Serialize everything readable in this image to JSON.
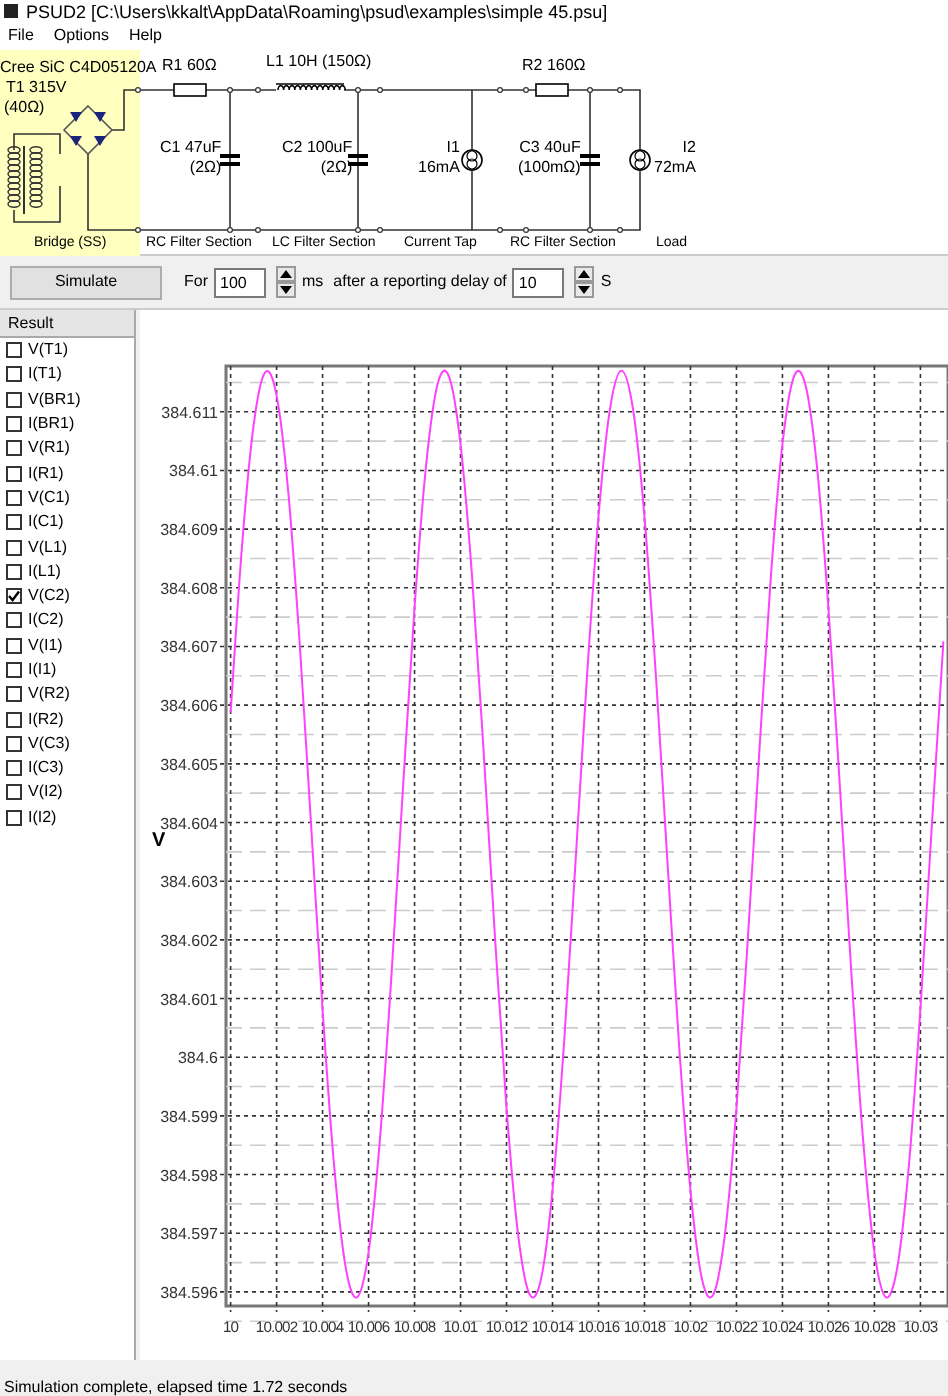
{
  "window": {
    "title": "PSUD2  [C:\\Users\\kkalt\\AppData\\Roaming\\psud\\examples\\simple 45.psu]"
  },
  "menu": [
    "File",
    "Options",
    "Help"
  ],
  "schematic": {
    "bridge": {
      "device": "Cree SiC C4D05120A",
      "transformer": "T1 315V",
      "resistance": "(40Ω)"
    },
    "components": [
      {
        "kind": "resistor",
        "lines": [
          "R1 60Ω"
        ]
      },
      {
        "kind": "capacitor",
        "lines": [
          "C1 47uF",
          "(2Ω)"
        ]
      },
      {
        "kind": "inductor",
        "lines": [
          "L1 10H (150Ω)"
        ]
      },
      {
        "kind": "capacitor",
        "lines": [
          "C2 100uF",
          "(2Ω)"
        ]
      },
      {
        "kind": "current_source",
        "lines": [
          "I1",
          "16mA"
        ]
      },
      {
        "kind": "resistor",
        "lines": [
          "R2 160Ω"
        ]
      },
      {
        "kind": "capacitor",
        "lines": [
          "C3 40uF",
          "(100mΩ)"
        ]
      },
      {
        "kind": "current_source",
        "lines": [
          "I2",
          "72mA"
        ]
      }
    ],
    "sections": [
      "Bridge (SS)",
      "RC Filter Section",
      "LC Filter Section",
      "Current Tap",
      "RC Filter Section",
      "Load"
    ]
  },
  "toolbar": {
    "button": "Simulate",
    "for_label": "For",
    "duration": "100",
    "duration_unit": "ms",
    "delay_label": "after a reporting delay of",
    "delay": "10",
    "delay_unit": "S"
  },
  "results": {
    "header": "Result",
    "items": [
      {
        "label": "V(T1)",
        "checked": false
      },
      {
        "label": "I(T1)",
        "checked": false
      },
      {
        "label": "V(BR1)",
        "checked": false
      },
      {
        "label": "I(BR1)",
        "checked": false
      },
      {
        "label": "V(R1)",
        "checked": false
      },
      {
        "label": "I(R1)",
        "checked": false
      },
      {
        "label": "V(C1)",
        "checked": false
      },
      {
        "label": "I(C1)",
        "checked": false
      },
      {
        "label": "V(L1)",
        "checked": false
      },
      {
        "label": "I(L1)",
        "checked": false
      },
      {
        "label": "V(C2)",
        "checked": true
      },
      {
        "label": "I(C2)",
        "checked": false
      },
      {
        "label": "V(I1)",
        "checked": false
      },
      {
        "label": "I(I1)",
        "checked": false
      },
      {
        "label": "V(R2)",
        "checked": false
      },
      {
        "label": "I(R2)",
        "checked": false
      },
      {
        "label": "V(C3)",
        "checked": false
      },
      {
        "label": "I(C3)",
        "checked": false
      },
      {
        "label": "V(I2)",
        "checked": false
      },
      {
        "label": "I(I2)",
        "checked": false
      }
    ]
  },
  "chart": {
    "chart_data": {
      "type": "line",
      "ylabel": "V",
      "grid": true,
      "x": [
        10,
        10.0005,
        10.001,
        10.0015,
        10.002,
        10.0025,
        10.003,
        10.0035,
        10.004,
        10.0045,
        10.005,
        10.0055,
        10.006,
        10.0065,
        10.007,
        10.0075,
        10.008,
        10.0085,
        10.009,
        10.0095,
        10.01,
        10.0105,
        10.011,
        10.0115,
        10.012,
        10.0125,
        10.013,
        10.0135,
        10.014,
        10.0145,
        10.015,
        10.0155,
        10.016,
        10.0165,
        10.017,
        10.0175,
        10.018,
        10.0185,
        10.019,
        10.0195,
        10.02,
        10.0205,
        10.021,
        10.0215,
        10.022,
        10.0225,
        10.023,
        10.0235,
        10.024,
        10.0245,
        10.025,
        10.0255,
        10.026,
        10.0265,
        10.027,
        10.0275,
        10.028,
        10.0285,
        10.029,
        10.0295,
        10.03,
        10.0305,
        10.031
      ],
      "series": [
        {
          "color": "#ff40ff",
          "values": [
            384.60587,
            384.60873,
            384.61077,
            384.61167,
            384.61128,
            384.60967,
            384.60708,
            384.60396,
            384.60081,
            384.59816,
            384.59643,
            384.59591,
            384.59668,
            384.59863,
            384.60142,
            384.60461,
            384.60766,
            384.61008,
            384.61147,
            384.6116,
            384.61045,
            384.6082,
            384.60524,
            384.60204,
            384.59913,
            384.59699,
            384.59596,
            384.59622,
            384.59773,
            384.60023,
            384.60332,
            384.60649,
            384.60922,
            384.61105,
            384.6117,
            384.61105,
            384.60921,
            384.60648,
            384.60332,
            384.60023,
            384.59773,
            384.59622,
            384.59596,
            384.59699,
            384.59913,
            384.60205,
            384.60524,
            384.60821,
            384.61045,
            384.6116,
            384.61146,
            384.61007,
            384.60765,
            384.6046,
            384.60142,
            384.59863,
            384.59668,
            384.59591,
            384.59643,
            384.59816,
            384.60082,
            384.60396,
            384.60709
          ]
        }
      ],
      "xlim": [
        9.9998,
        10.0312
      ],
      "ylim": [
        384.59576,
        384.61178
      ],
      "xticks": [
        10,
        10.002,
        10.004,
        10.006,
        10.008,
        10.01,
        10.012,
        10.014,
        10.016,
        10.018,
        10.02,
        10.022,
        10.024,
        10.026,
        10.028,
        10.03
      ],
      "yticks": [
        384.596,
        384.597,
        384.598,
        384.599,
        384.6,
        384.601,
        384.602,
        384.603,
        384.604,
        384.605,
        384.606,
        384.607,
        384.608,
        384.609,
        384.61,
        384.611
      ]
    }
  },
  "status_bar": "Simulation complete, elapsed time 1.72 seconds"
}
